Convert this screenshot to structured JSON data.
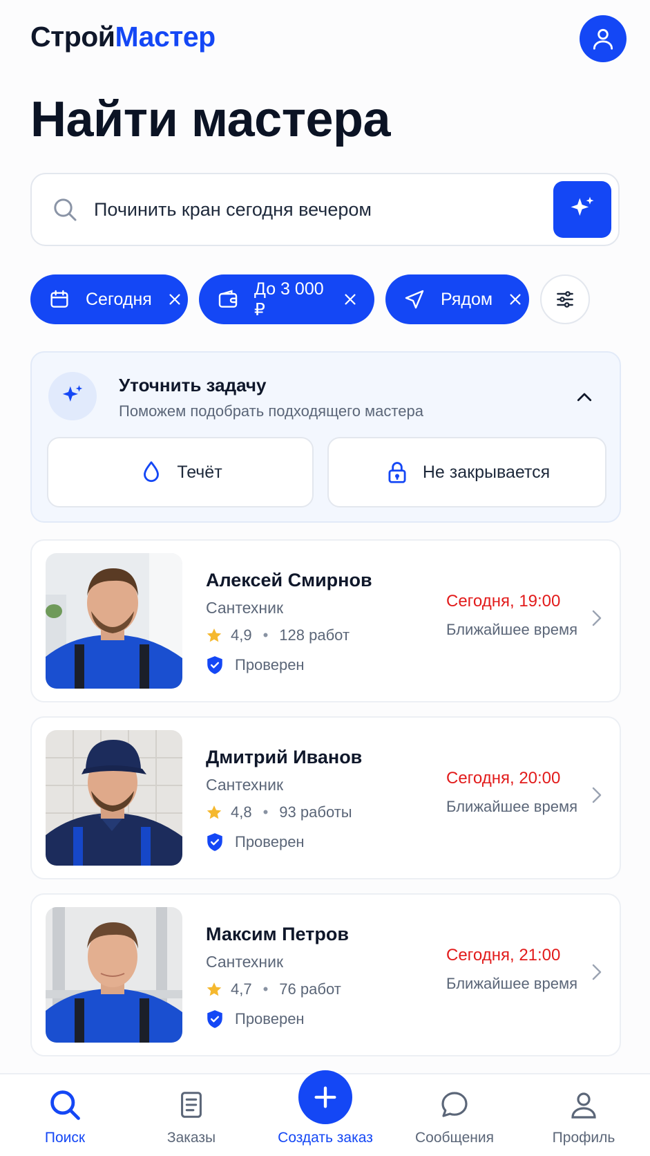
{
  "app": {
    "logo_part1": "Строй",
    "logo_part2": "Мастер",
    "accent_color": "#1447f5"
  },
  "page": {
    "title": "Найти мастера"
  },
  "search": {
    "value": "Починить кран сегодня вечером",
    "icon": "search-icon",
    "ai_icon": "sparkle-icon"
  },
  "filters": [
    {
      "label": "Сегодня",
      "icon": "calendar-icon"
    },
    {
      "label": "До 3 000 ₽",
      "icon": "wallet-icon"
    },
    {
      "label": "Рядом",
      "icon": "location-arrow-icon"
    }
  ],
  "refine": {
    "title": "Уточнить задачу",
    "subtitle": "Поможем подобрать подходящего мастера",
    "options": [
      {
        "label": "Течёт",
        "icon": "drop-icon"
      },
      {
        "label": "Не закрывается",
        "icon": "lock-icon"
      }
    ]
  },
  "masters": [
    {
      "name": "Алексей Смирнов",
      "profession": "Сантехник",
      "rating": "4,9",
      "jobs": "128 работ",
      "verified": "Проверен",
      "time": "Сегодня, 19:00",
      "time_label": "Ближайшее время"
    },
    {
      "name": "Дмитрий Иванов",
      "profession": "Сантехник",
      "rating": "4,8",
      "jobs": "93 работы",
      "verified": "Проверен",
      "time": "Сегодня, 20:00",
      "time_label": "Ближайшее время"
    },
    {
      "name": "Максим Петров",
      "profession": "Сантехник",
      "rating": "4,7",
      "jobs": "76 работ",
      "verified": "Проверен",
      "time": "Сегодня, 21:00",
      "time_label": "Ближайшее время"
    }
  ],
  "nav": {
    "search": "Поиск",
    "orders": "Заказы",
    "create": "Создать заказ",
    "messages": "Сообщения",
    "profile": "Профиль"
  }
}
